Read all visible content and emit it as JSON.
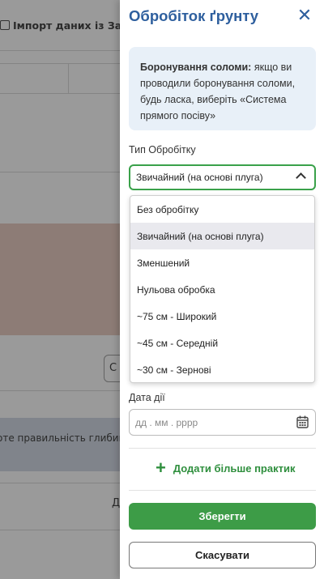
{
  "background": {
    "import_label": "Імпорт даних із Завдан",
    "button_label": "С",
    "band_text": "оте правильність глибини",
    "row_label": "Д"
  },
  "panel": {
    "title": "Обробіток ґрунту",
    "close_icon": "close-icon",
    "info": {
      "bold": "Боронування соломи:",
      "text": " якщо ви проводили боронування соломи, будь ласка, виберіть «Система прямого посіву»"
    },
    "type_label": "Тип Обробітку",
    "type_value": "Звичайний (на основі плуга)",
    "options": [
      "Без обробітку",
      "Звичайний (на основі плуга)",
      "Зменшений",
      "Нульова обробка",
      "~75 см - Широкий",
      "~45 см - Середній",
      "~30 см - Зернові"
    ],
    "selected_option": "Звичайний (на основі плуга)",
    "date_label": "Дата дії",
    "date_placeholder": "дд . мм . рррр",
    "add_practice_label": "Додати більше практик",
    "save_label": "Зберегти",
    "cancel_label": "Скасувати"
  },
  "colors": {
    "accent_blue": "#2e5f9e",
    "accent_green": "#3d9c47",
    "info_bg": "#e8f0f8"
  }
}
